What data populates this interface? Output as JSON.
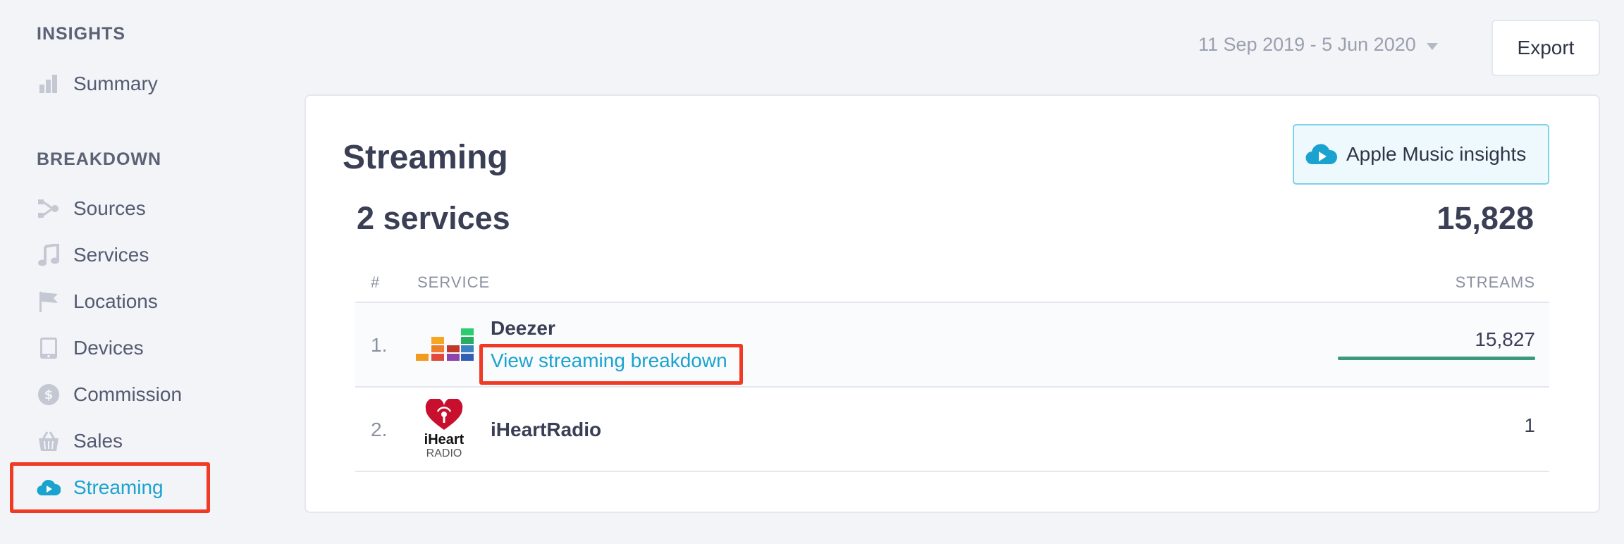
{
  "sidebar": {
    "insights_title": "INSIGHTS",
    "summary": "Summary",
    "breakdown_title": "BREAKDOWN",
    "items": [
      {
        "label": "Sources",
        "icon": "sources-icon"
      },
      {
        "label": "Services",
        "icon": "music-note-icon"
      },
      {
        "label": "Locations",
        "icon": "flag-icon"
      },
      {
        "label": "Devices",
        "icon": "tablet-icon"
      },
      {
        "label": "Commission",
        "icon": "dollar-coin-icon"
      },
      {
        "label": "Sales",
        "icon": "basket-icon"
      },
      {
        "label": "Streaming",
        "icon": "cloud-play-icon",
        "active": true
      }
    ]
  },
  "header": {
    "date_range": "11 Sep 2019 - 5 Jun 2020",
    "export_label": "Export"
  },
  "card": {
    "title": "Streaming",
    "apple_button": "Apple Music insights",
    "services_count": "2 services",
    "total_streams": "15,828",
    "columns": {
      "num": "#",
      "service": "SERVICE",
      "streams": "STREAMS"
    },
    "rows": [
      {
        "num": "1.",
        "name": "Deezer",
        "link": "View streaming breakdown",
        "streams": "15,827",
        "share": 0.9999
      },
      {
        "num": "2.",
        "name": "iHeartRadio",
        "streams": "1",
        "logo_text_top": "iHeart",
        "logo_text_bottom": "RADIO"
      }
    ]
  },
  "colors": {
    "accent": "#1aa3cf",
    "highlight": "#f03a24",
    "bar": "#3c9a79"
  }
}
